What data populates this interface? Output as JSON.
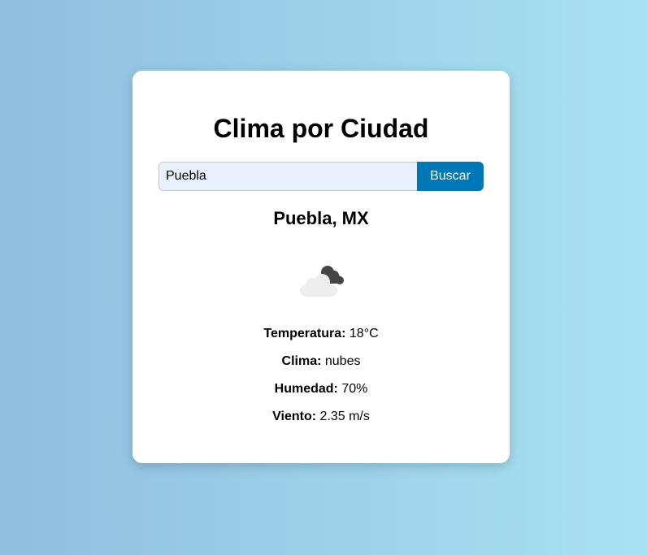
{
  "app": {
    "title": "Clima por Ciudad"
  },
  "search": {
    "value": "Puebla",
    "button_label": "Buscar"
  },
  "result": {
    "location": "Puebla, MX",
    "icon": "broken-clouds-icon",
    "details": [
      {
        "label": "Temperatura:",
        "value": "18°C"
      },
      {
        "label": "Clima:",
        "value": "nubes"
      },
      {
        "label": "Humedad:",
        "value": "70%"
      },
      {
        "label": "Viento:",
        "value": "2.35 m/s"
      }
    ]
  },
  "colors": {
    "button": "#0077b6",
    "input_bg": "#e8f0fe",
    "background_start": "#8fbfe0",
    "background_end": "#a8e2f2"
  }
}
